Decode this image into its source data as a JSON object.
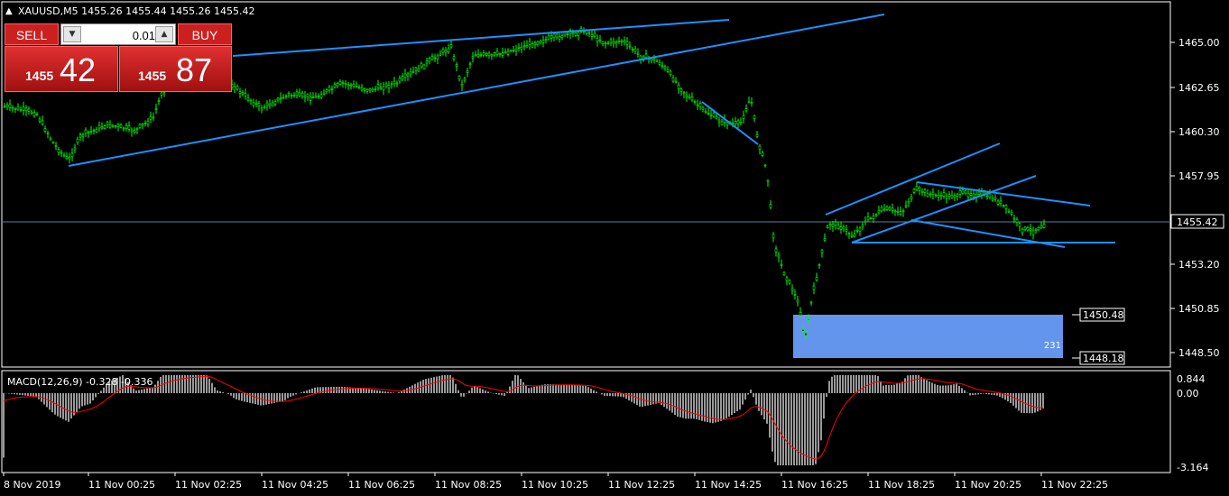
{
  "symbol_header": {
    "arrow": "▲",
    "text": "XAUUSD,M5  1455.26 1455.44 1455.26 1455.42"
  },
  "trade_panel": {
    "sell_label": "SELL",
    "buy_label": "BUY",
    "lot_value": "0.01",
    "sell_price_small": "1455",
    "sell_price_big": "42",
    "buy_price_small": "1455",
    "buy_price_big": "87"
  },
  "price_axis": {
    "ticks": [
      "1465.00",
      "1462.65",
      "1460.30",
      "1457.95",
      "1455.42",
      "1453.20",
      "1450.85",
      "1448.50"
    ],
    "current_price": "1455.42"
  },
  "rectangle": {
    "upper_label": "1450.48",
    "lower_label": "1448.18",
    "count_label": "231",
    "color": "#6495ed"
  },
  "macd": {
    "label": "MACD(12,26,9) -0.328 -0.336",
    "axis_ticks": [
      "0.844",
      "0.00",
      "-3.164"
    ]
  },
  "time_axis": {
    "labels": [
      "8 Nov 2019",
      "11 Nov 00:25",
      "11 Nov 02:25",
      "11 Nov 04:25",
      "11 Nov 06:25",
      "11 Nov 08:25",
      "11 Nov 10:25",
      "11 Nov 12:25",
      "11 Nov 14:25",
      "11 Nov 16:25",
      "11 Nov 18:25",
      "11 Nov 20:25",
      "11 Nov 22:25"
    ]
  },
  "colors": {
    "candles": "#00ff00",
    "trendlines": "#1e90ff",
    "macd_histogram": "#c0c0c0",
    "macd_signal": "#ff0000"
  }
}
